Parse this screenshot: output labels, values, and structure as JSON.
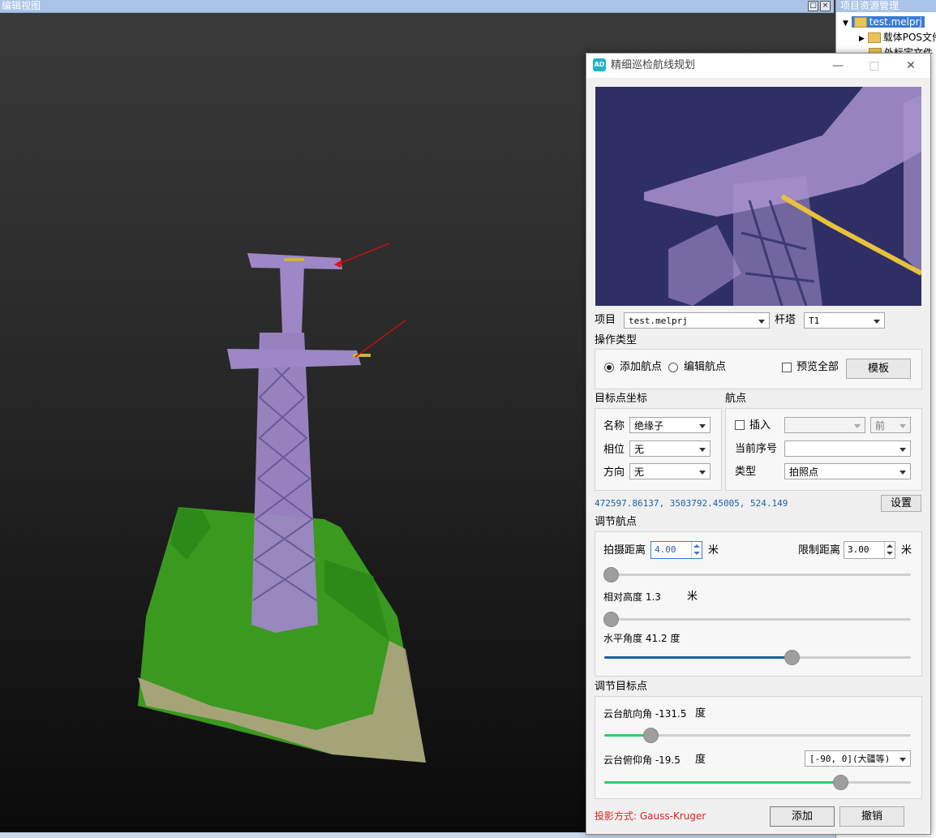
{
  "viewport": {
    "title": "编辑视图",
    "ctrl_restore": "□",
    "ctrl_close": "×"
  },
  "project_panel": {
    "title": "项目资源管理",
    "items": [
      {
        "label": "test.melprj"
      },
      {
        "label": "载体POS文件"
      },
      {
        "label": "外标定文件"
      }
    ]
  },
  "dialog": {
    "title": "精细巡检航线规划",
    "logo": "AD",
    "win_min": "—",
    "win_max": "□",
    "win_close": "✕",
    "project_label": "项目",
    "project_value": "test.melprj",
    "tower_label": "杆塔",
    "tower_value": "T1",
    "op_type_label": "操作类型",
    "op_add": "添加航点",
    "op_edit": "编辑航点",
    "preview_all": "预览全部",
    "template_btn": "模板",
    "target_coord_label": "目标点坐标",
    "waypoint_label": "航点",
    "name_label": "名称",
    "name_value": "绝缘子",
    "phase_label": "相位",
    "phase_value": "无",
    "direction_label": "方向",
    "direction_value": "无",
    "insert_label": "插入",
    "insert_value": "",
    "insert_pos_value": "前",
    "current_index_label": "当前序号",
    "current_index_value": "",
    "type_label": "类型",
    "type_value": "拍照点",
    "coordinates": "472597.86137, 3503792.45005, 524.149",
    "set_btn": "设置",
    "adjust_waypoint_label": "调节航点",
    "shoot_distance_label": "拍摄距离",
    "shoot_distance_value": "4.00",
    "unit_m": "米",
    "limit_distance_label": "限制距离",
    "limit_distance_value": "3.00",
    "relative_height_text": "相对高度 1.3",
    "horizontal_angle_text": "水平角度 41.2 度",
    "adjust_target_label": "调节目标点",
    "gimbal_yaw_text": "云台航向角 -131.5",
    "gimbal_pitch_text": "云台俯仰角 -19.5",
    "unit_deg": "度",
    "pitch_range_value": "[-90, 0](大疆等)",
    "projection_text": "投影方式: Gauss-Kruger",
    "add_btn": "添加",
    "cancel_btn": "撤销",
    "sliders": {
      "shoot_distance": 0.02,
      "relative_height": 0.02,
      "horizontal_angle": 0.61,
      "gimbal_yaw": 0.15,
      "gimbal_pitch": 0.77
    },
    "colors": {
      "accent_blue": "#1a5fa8",
      "accent_green": "#2ecc71",
      "coord_blue": "#1a5fa8",
      "projection_red": "#e02020"
    }
  }
}
